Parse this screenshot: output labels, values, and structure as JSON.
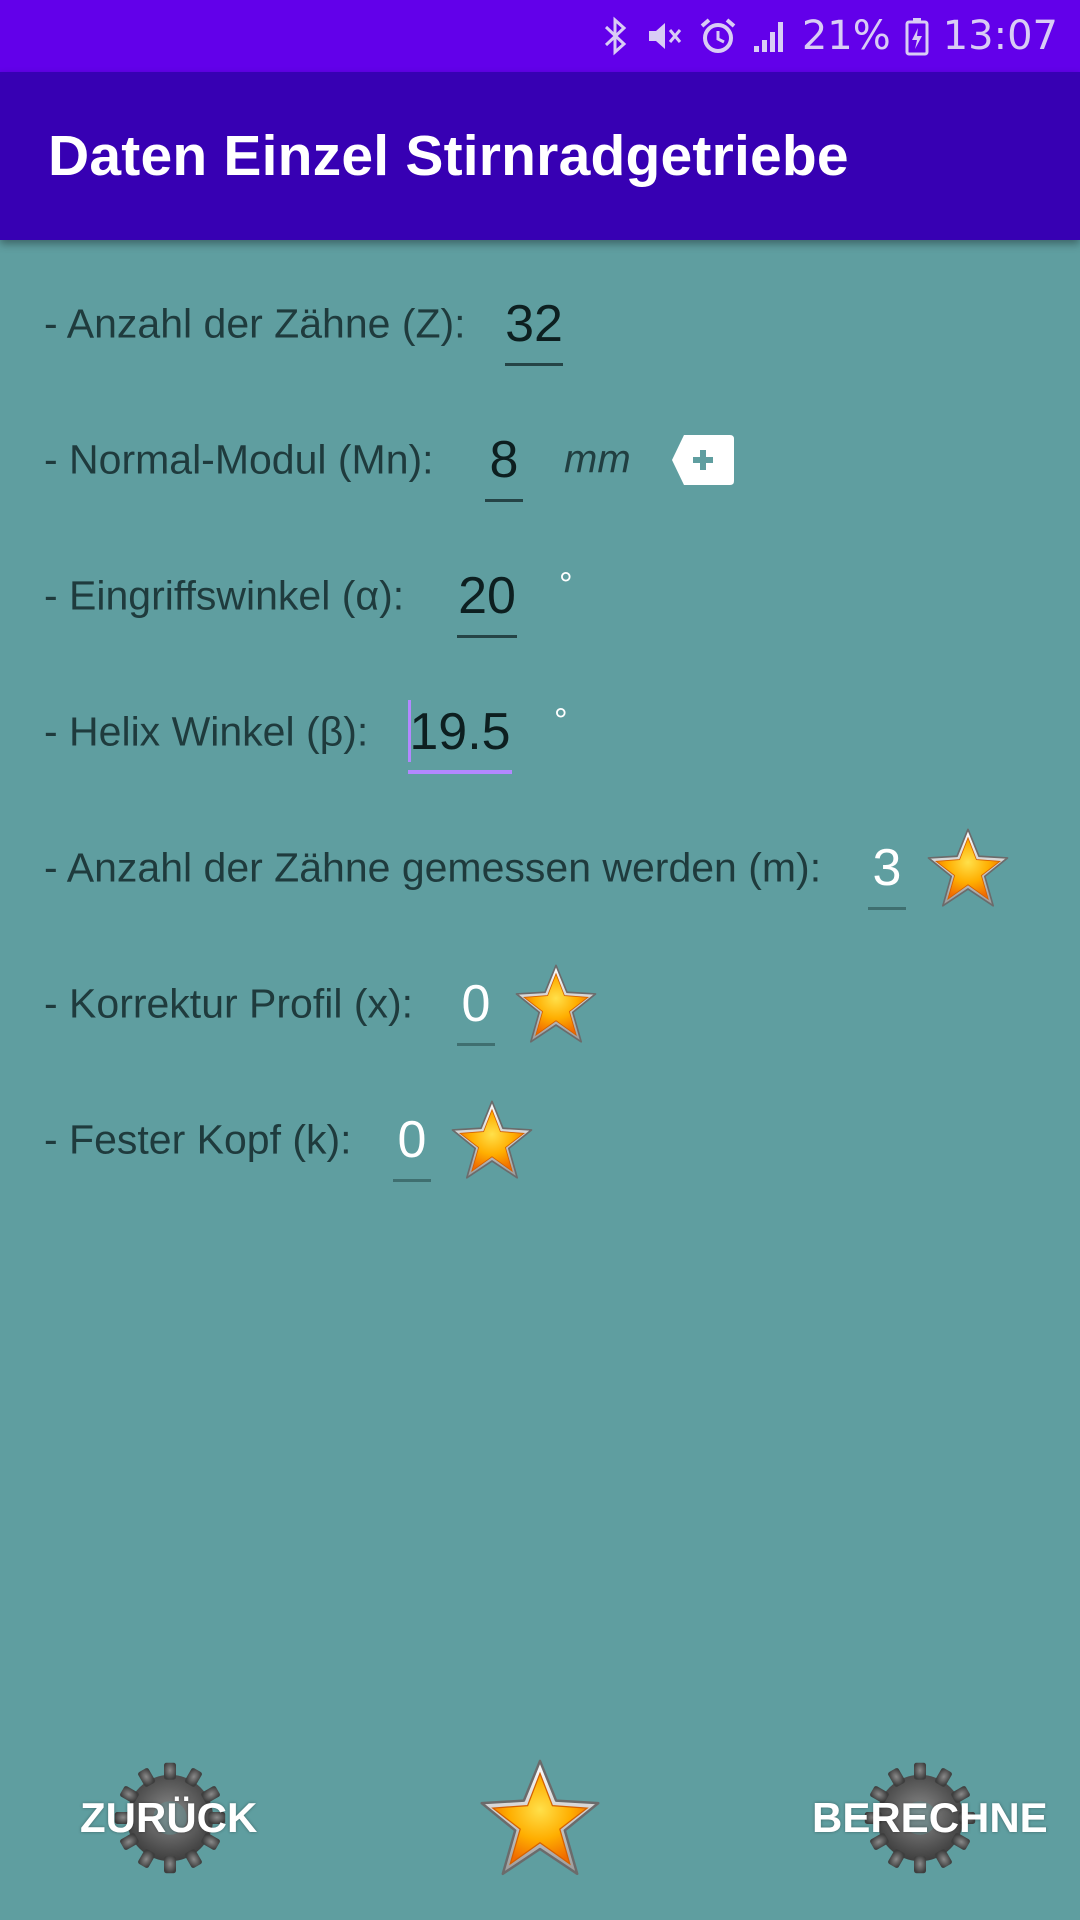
{
  "status_bar": {
    "battery_percent": "21%",
    "time": "13:07",
    "icons": [
      "bluetooth-icon",
      "mute-icon",
      "alarm-icon",
      "signal-icon",
      "battery-charging-icon"
    ]
  },
  "app_bar": {
    "title": "Daten Einzel Stirnradgetriebe"
  },
  "form": {
    "teeth": {
      "label": "- Anzahl der Zähne (Z):",
      "value": "32"
    },
    "module": {
      "label": "- Normal-Modul (Mn):",
      "value": "8",
      "unit": "mm"
    },
    "pressure_angle": {
      "label": "- Eingriffswinkel (α):",
      "value": "20",
      "unit": "°"
    },
    "helix_angle": {
      "label": "- Helix Winkel (β):",
      "value": "19.5",
      "unit": "°"
    },
    "measured_teeth": {
      "label": "- Anzahl der Zähne gemessen werden (m):",
      "value": "3"
    },
    "profile_correction": {
      "label": "- Korrektur Profil (x):",
      "value": "0"
    },
    "fixed_head": {
      "label": "- Fester Kopf (k):",
      "value": "0"
    }
  },
  "bottom": {
    "back_label": "ZURÜCK",
    "calc_label": "BERECHNE"
  },
  "colors": {
    "status_bar": "#6200ea",
    "app_bar": "#3700b3",
    "background": "#5f9ea0",
    "focus_accent": "#b388ff"
  }
}
